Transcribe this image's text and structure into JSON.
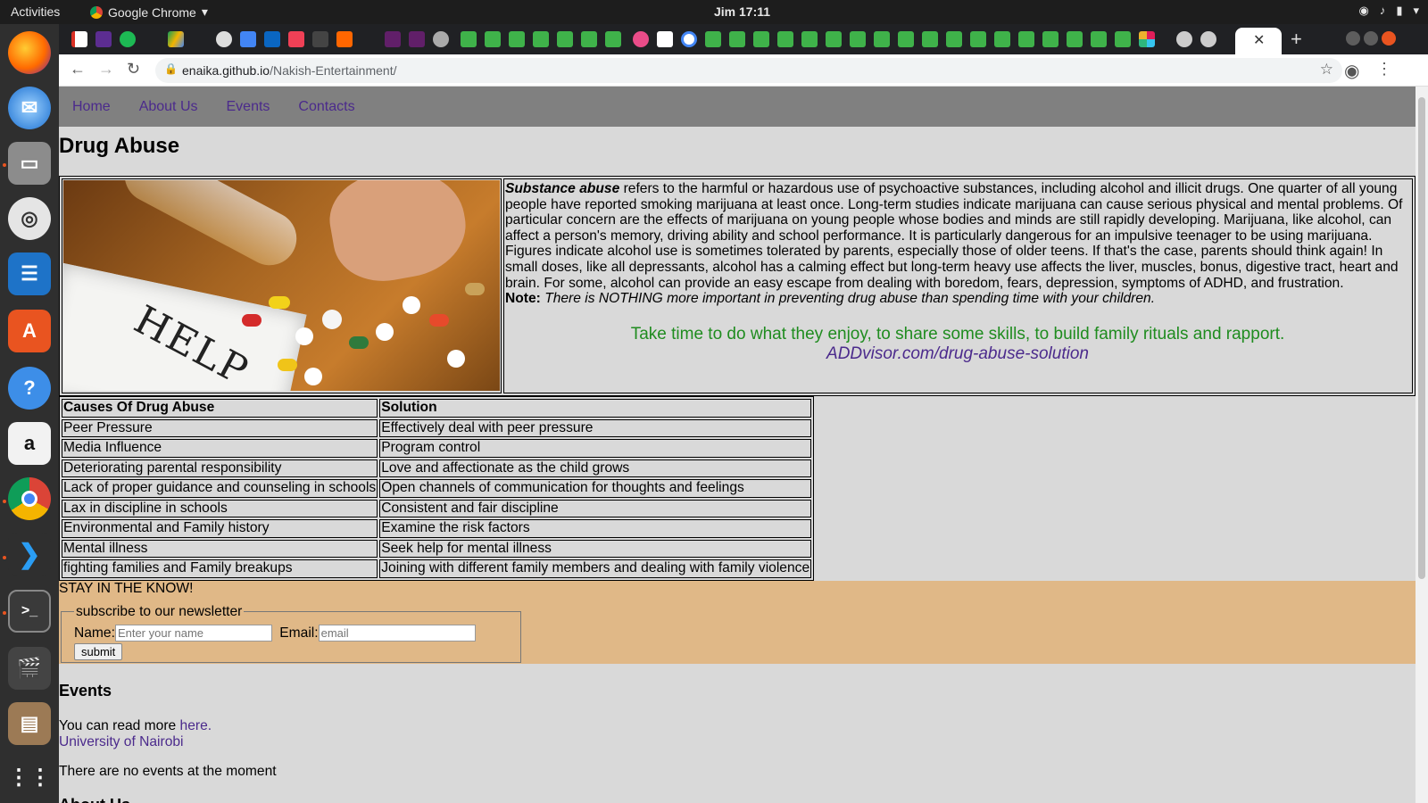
{
  "topbar": {
    "activities": "Activities",
    "app_name": "Google Chrome",
    "clock": "Jim 17:11"
  },
  "dock": {
    "items": [
      "Firefox",
      "Thunderbird",
      "Files",
      "Rhythmbox",
      "Writer",
      "Software",
      "Help",
      "Amazon",
      "Chrome",
      "VS Code",
      "Terminal",
      "Video",
      "Archive",
      "Apps"
    ]
  },
  "browser": {
    "url_host": "enaika.github.io",
    "url_path": "/Nakish-Entertainment/",
    "new_tab": "+",
    "close_tab": "✕"
  },
  "nav": {
    "items": [
      "Home",
      "About Us",
      "Events",
      "Contacts"
    ]
  },
  "page": {
    "title": "Drug Abuse",
    "image_text": "HELP",
    "intro_bold": "Substance abuse",
    "intro_text": " refers to the harmful or hazardous use of psychoactive substances, including alcohol and illicit drugs. One quarter of all young people have reported smoking marijuana at least once. Long-term studies indicate marijuana can cause serious physical and mental problems. Of particular concern are the effects of marijuana on young people whose bodies and minds are still rapidly developing. Marijuana, like alcohol, can affect a person's memory, driving ability and school performance. It is particularly dangerous for an impulsive teenager to be using marijuana. Figures indicate alcohol use is sometimes tolerated by parents, especially those of older teens. If that's the case, parents should think again! In small doses, like all depressants, alcohol has a calming effect but long-term heavy use affects the liver, muscles, bonus, digestive tract, heart and brain. For some, alcohol can provide an easy escape from dealing with boredom, fears, depression, symptoms of ADHD, and frustration.",
    "note_label": "Note:",
    "note_text": " There is NOTHING more important in preventing drug abuse than spending time with your children.",
    "quote": "Take time to do what they enjoy, to share some skills, to build family rituals and rapport.",
    "quote_source": "ADDvisor.com/drug-abuse-solution"
  },
  "causes_table": {
    "headers": [
      "Causes Of Drug Abuse",
      "Solution"
    ],
    "rows": [
      [
        "Peer Pressure",
        "Effectively deal with peer pressure"
      ],
      [
        "Media Influence",
        "Program control"
      ],
      [
        "Deteriorating parental responsibility",
        "Love and affectionate as the child grows"
      ],
      [
        "Lack of proper guidance and counseling in schools",
        "Open channels of communication for thoughts and feelings"
      ],
      [
        "Lax in discipline in schools",
        "Consistent and fair discipline"
      ],
      [
        "Environmental and Family history",
        "Examine the risk factors"
      ],
      [
        "Mental illness",
        "Seek help for mental illness"
      ],
      [
        "fighting families and Family breakups",
        "Joining with different family members and dealing with family violence"
      ]
    ]
  },
  "newsletter": {
    "heading": "STAY IN THE KNOW!",
    "legend": "subscribe to our newsletter",
    "name_label": "Name:",
    "name_placeholder": "Enter your name",
    "email_label": "Email:",
    "email_placeholder": "email",
    "submit": "submit"
  },
  "events": {
    "heading": "Events",
    "read_more": "You can read more ",
    "here_link": "here.",
    "university_link": "University of Nairobi",
    "none": "There are no events at the moment"
  },
  "about": {
    "heading": "About Us"
  },
  "colors": {
    "page_bg": "#d9d9d9",
    "nav_bg": "#808080",
    "link": "#4b2a8c",
    "quote_green": "#1f8c1f",
    "newsletter_bg": "#e0b887"
  }
}
